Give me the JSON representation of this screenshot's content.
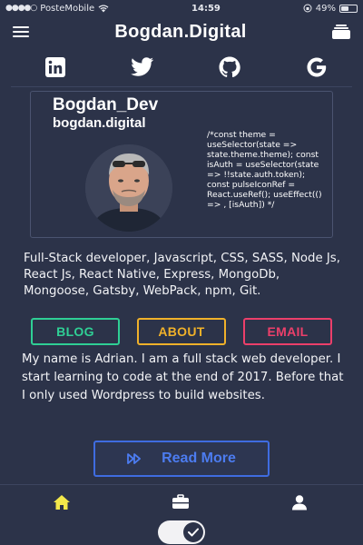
{
  "status_bar": {
    "carrier": "PosteMobile",
    "time": "14:59",
    "battery": "49%",
    "battery_level": 0.49
  },
  "header": {
    "brand": "Bogdan.Digital"
  },
  "social": [
    "linkedin-icon",
    "twitter-icon",
    "github-icon",
    "google-icon"
  ],
  "profile": {
    "name": "Bogdan_Dev",
    "site": "bogdan.digital",
    "code": "/*const theme = useSelector(state => state.theme.theme); const isAuth = useSelector(state => !!state.auth.token); const pulseIconRef = React.useRef(); useEffect(() => , [isAuth]) */"
  },
  "skills_text": "Full-Stack developer, Javascript, CSS, SASS, Node Js, React Js, React Native, Express, MongoDb, Mongoose, Gatsby, WebPack, npm, Git.",
  "buttons": {
    "blog": "BLOG",
    "about": "ABOUT",
    "email": "EMAIL"
  },
  "bio": "My name is Adrian. I am a full stack web developer. I start learning to code at the end of 2017. Before that I only used Wordpress to build websites.",
  "read_more": "Read More",
  "colors": {
    "background": "#2c3349",
    "blog": "#2fcf95",
    "about": "#f0b12a",
    "email": "#ec3f6a",
    "read_more": "#3f6ce0",
    "active_nav": "#f3e84a"
  },
  "bottom_nav": [
    "home-icon",
    "briefcase-icon",
    "user-icon"
  ],
  "theme_toggle": {
    "on": true
  }
}
